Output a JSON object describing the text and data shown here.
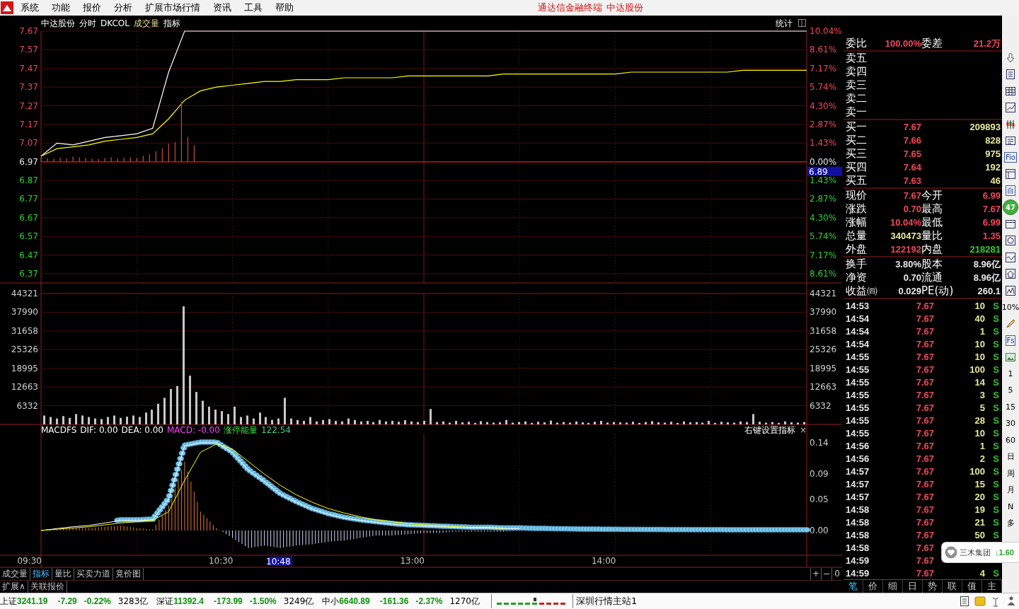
{
  "menu": {
    "items": [
      "系统",
      "功能",
      "报价",
      "分析",
      "扩展市场行情",
      "资讯",
      "工具",
      "帮助"
    ],
    "app_title": "通达信金融终端",
    "stock": "中达股份"
  },
  "chart_header": {
    "items": [
      "中达股份",
      "分时",
      "DKCOL",
      "成交量",
      "指标"
    ],
    "stats_button": "统计"
  },
  "price_chart": {
    "chart_data": {
      "type": "line",
      "ylim": [
        6.37,
        7.67
      ],
      "categories": [
        null,
        null,
        null,
        null,
        null,
        null,
        null,
        null,
        null,
        null,
        null,
        null,
        null,
        null,
        null,
        null,
        null,
        null,
        null,
        null,
        null,
        null,
        null,
        null,
        null,
        null,
        null,
        null,
        null,
        null,
        null,
        null,
        null,
        null,
        null,
        null,
        null,
        null,
        null,
        null,
        null,
        null,
        null,
        null,
        null,
        null,
        null,
        null,
        null
      ],
      "yticks": [
        {
          "value": 7.67,
          "label": "7.67"
        },
        {
          "value": 7.57,
          "label": "7.57"
        },
        {
          "value": 7.47,
          "label": "7.47"
        },
        {
          "value": 7.37,
          "label": "7.37"
        },
        {
          "value": 7.27,
          "label": "7.27"
        },
        {
          "value": 7.17,
          "label": "7.17"
        },
        {
          "value": 7.07,
          "label": "7.07"
        },
        {
          "value": 6.97,
          "label": "6.97"
        },
        {
          "value": 6.87,
          "label": "6.87"
        },
        {
          "value": 6.77,
          "label": "6.77"
        },
        {
          "value": 6.67,
          "label": "6.67"
        },
        {
          "value": 6.57,
          "label": "6.57"
        },
        {
          "value": 6.47,
          "label": "6.47"
        },
        {
          "value": 6.37,
          "label": "6.37"
        }
      ],
      "series": [
        {
          "color": "#ffffff",
          "values": [
            7.0,
            7.07,
            7.06,
            7.08,
            7.1,
            7.11,
            7.12,
            7.15,
            7.45,
            7.67,
            7.67,
            7.67,
            7.67,
            7.67,
            7.67,
            7.67,
            7.67,
            7.67,
            7.67,
            7.67,
            7.67,
            7.67,
            7.67,
            7.67,
            7.67,
            7.67,
            7.67,
            7.67,
            7.67,
            7.67,
            7.67,
            7.67,
            7.67,
            7.67,
            7.67,
            7.67,
            7.67,
            7.67,
            7.67,
            7.67,
            7.67,
            7.67,
            7.67,
            7.67,
            7.67,
            7.67,
            7.67,
            7.67,
            7.67
          ]
        },
        {
          "color": "#ffff00",
          "values": [
            7.0,
            7.04,
            7.05,
            7.06,
            7.08,
            7.09,
            7.1,
            7.12,
            7.2,
            7.3,
            7.35,
            7.37,
            7.38,
            7.39,
            7.4,
            7.4,
            7.41,
            7.41,
            7.41,
            7.42,
            7.42,
            7.42,
            7.42,
            7.43,
            7.43,
            7.43,
            7.43,
            7.43,
            7.43,
            7.44,
            7.44,
            7.44,
            7.44,
            7.44,
            7.44,
            7.44,
            7.44,
            7.45,
            7.45,
            7.45,
            7.45,
            7.45,
            7.45,
            7.45,
            7.46,
            7.46,
            7.46,
            7.46,
            7.46
          ]
        }
      ]
    },
    "cursor_label": "6.89",
    "right_labels": [
      {
        "label": "10.04%",
        "color": "#f04858"
      },
      {
        "label": "8.61%",
        "color": "#f04858"
      },
      {
        "label": "7.17%",
        "color": "#f04858"
      },
      {
        "label": "5.74%",
        "color": "#f04858"
      },
      {
        "label": "4.30%",
        "color": "#f04858"
      },
      {
        "label": "2.87%",
        "color": "#f04858"
      },
      {
        "label": "1.43%",
        "color": "#f04858"
      },
      {
        "label": "0.00%",
        "color": "#e8e8e8"
      },
      {
        "label": "1.43%",
        "color": "#30d030"
      },
      {
        "label": "2.87%",
        "color": "#30d030"
      },
      {
        "label": "4.30%",
        "color": "#30d030"
      },
      {
        "label": "5.74%",
        "color": "#30d030"
      },
      {
        "label": "7.17%",
        "color": "#30d030"
      },
      {
        "label": "8.61%",
        "color": "#30d030"
      }
    ]
  },
  "volume_chart": {
    "chart_data": {
      "type": "bar",
      "ylim": [
        0,
        44321
      ],
      "yticks": [
        {
          "value": 44321,
          "label": "44321"
        },
        {
          "value": 37990,
          "label": "37990"
        },
        {
          "value": 31658,
          "label": "31658"
        },
        {
          "value": 25326,
          "label": "25326"
        },
        {
          "value": 18995,
          "label": "18995"
        },
        {
          "value": 12663,
          "label": "12663"
        },
        {
          "value": 6332,
          "label": "6332"
        }
      ],
      "categories": [
        null,
        null,
        null,
        null,
        null,
        null,
        null,
        null,
        null,
        null,
        null,
        null,
        null,
        null,
        null,
        null,
        null,
        null,
        null,
        null,
        null,
        null,
        null,
        null,
        null,
        null,
        null,
        null,
        null,
        null,
        null,
        null,
        null,
        null,
        null,
        null,
        null,
        null,
        null,
        null,
        null,
        null,
        null,
        null,
        null,
        null,
        null,
        null,
        null,
        null,
        null,
        null,
        null,
        null,
        null,
        null,
        null,
        null,
        null,
        null,
        null,
        null,
        null,
        null,
        null,
        null,
        null,
        null,
        null,
        null,
        null,
        null,
        null,
        null,
        null,
        null,
        null,
        null,
        null,
        null,
        null,
        null,
        null,
        null,
        null,
        null,
        null,
        null,
        null,
        null,
        null,
        null,
        null,
        null,
        null,
        null,
        null,
        null,
        null,
        null,
        null,
        null,
        null,
        null,
        null,
        null,
        null,
        null,
        null,
        null,
        null,
        null,
        null,
        null,
        null,
        null,
        null,
        null,
        null,
        null,
        null
      ],
      "series": [
        {
          "color": "#c8c8c8",
          "values": [
            3000,
            2500,
            2000,
            2800,
            2200,
            3500,
            3000,
            2500,
            2000,
            1800,
            2500,
            3000,
            2200,
            2600,
            3000,
            2500,
            4000,
            5000,
            7000,
            9000,
            12000,
            13000,
            40000,
            16500,
            11000,
            8000,
            6000,
            5000,
            4500,
            3500,
            6000,
            2500,
            3000,
            2000,
            4000,
            2500,
            1500,
            2000,
            9000,
            2000,
            1500,
            1200,
            2500,
            1000,
            1500,
            1800,
            1200,
            1000,
            2000,
            1500,
            1000,
            1200,
            800,
            1500,
            1000,
            1200,
            900,
            1400,
            1000,
            800,
            1200,
            5200,
            800,
            1000,
            600,
            1200,
            700,
            900,
            500,
            1100,
            800,
            600,
            700,
            1500,
            600,
            800,
            1000,
            500,
            900,
            700,
            1300,
            600,
            800,
            600,
            1000,
            700,
            500,
            900,
            1200,
            600,
            800,
            700,
            600,
            900,
            500,
            800,
            1100,
            700,
            600,
            900,
            500,
            1000,
            700,
            800,
            600,
            1200,
            500,
            900,
            700,
            600,
            1000,
            800,
            3500,
            900,
            600,
            800,
            500,
            1000,
            700,
            600,
            800
          ]
        }
      ]
    },
    "right_labels": [
      "44321",
      "37990",
      "31658",
      "25326",
      "18995",
      "12663",
      "6332"
    ]
  },
  "macd_chart": {
    "legend": [
      "MACDFS",
      "DIF: 0.00",
      "DEA: 0.00",
      "MACD: -0.00",
      "涨停能量",
      "122.54"
    ],
    "settings_hint": "右键设置指标",
    "close": "×",
    "chart_data": {
      "type": "line",
      "ylim": [
        0,
        0.14
      ],
      "categories": [
        null,
        null,
        null,
        null,
        null,
        null,
        null,
        null,
        null,
        null,
        null,
        null,
        null,
        null,
        null,
        null,
        null,
        null,
        null,
        null,
        null,
        null,
        null,
        null,
        null,
        null,
        null,
        null,
        null,
        null,
        null,
        null,
        null,
        null,
        null,
        null,
        null,
        null,
        null,
        null,
        null,
        null,
        null,
        null,
        null,
        null,
        null,
        null,
        null
      ],
      "yticks": [
        {
          "value": 0.14,
          "label": "0.14"
        },
        {
          "value": 0.09,
          "label": "0.09"
        },
        {
          "value": 0.05,
          "label": "0.05"
        },
        {
          "value": 0,
          "label": "0.00"
        }
      ],
      "series": [
        {
          "color": "#ffffff",
          "values": [
            0,
            0.003,
            0.006,
            0.008,
            0.012,
            0.016,
            0.016,
            0.017,
            0.05,
            0.135,
            0.14,
            0.14,
            0.124,
            0.096,
            0.078,
            0.058,
            0.045,
            0.034,
            0.026,
            0.02,
            0.016,
            0.013,
            0.01,
            0.008,
            0.007,
            0.006,
            0.005,
            0.004,
            0.004,
            0.003,
            0.003,
            null,
            null,
            null,
            null,
            null,
            null,
            null,
            null,
            null,
            null,
            null,
            null,
            null,
            null,
            null,
            null,
            null,
            null
          ]
        },
        {
          "color": "#ffff00",
          "values": [
            0,
            0.002,
            0.004,
            0.006,
            0.009,
            0.012,
            0.014,
            0.016,
            0.03,
            0.08,
            0.125,
            0.138,
            0.13,
            0.11,
            0.09,
            0.072,
            0.057,
            0.045,
            0.035,
            0.028,
            0.022,
            0.017,
            0.014,
            0.011,
            0.009,
            0.008,
            0.006,
            0.005,
            0.005,
            0.004,
            null,
            null,
            null,
            null,
            null,
            null,
            null,
            null,
            null,
            null,
            null,
            null,
            null,
            null,
            null,
            null,
            null,
            null,
            null
          ]
        }
      ]
    },
    "time_labels": [
      "09:30",
      "10:30",
      "13:00",
      "14:00"
    ],
    "cursor_time": "10:48"
  },
  "bottom_tabs": [
    {
      "label": "成交量",
      "selected": false
    },
    {
      "label": "指标",
      "selected": true
    },
    {
      "label": "量比",
      "selected": false
    },
    {
      "label": "买卖力道",
      "selected": false
    },
    {
      "label": "竟价图",
      "selected": false
    }
  ],
  "zoom_buttons": [
    "+",
    "−",
    "0"
  ],
  "sub_tabs": [
    "扩展∧",
    "关联报价"
  ],
  "quote": {
    "order_ratio": [
      {
        "label": "委比",
        "value": "100.00%",
        "color": "#f04858"
      },
      {
        "label": "委差",
        "value": "21.2万",
        "color": "#f04858"
      }
    ],
    "sell": [
      "卖五",
      "卖四",
      "卖三",
      "卖二",
      "卖一"
    ],
    "buy": [
      {
        "label": "买一",
        "price": "7.67",
        "volume": "209893"
      },
      {
        "label": "买二",
        "price": "7.66",
        "volume": "828"
      },
      {
        "label": "买三",
        "price": "7.65",
        "volume": "975"
      },
      {
        "label": "买四",
        "price": "7.64",
        "volume": "192"
      },
      {
        "label": "买五",
        "price": "7.63",
        "volume": "46"
      }
    ],
    "stats": [
      [
        {
          "label": "现价",
          "value": "7.67",
          "color": "#f04858"
        },
        {
          "label": "今开",
          "value": "6.99",
          "color": "#f04858"
        }
      ],
      [
        {
          "label": "涨跌",
          "value": "0.70",
          "color": "#f04858"
        },
        {
          "label": "最高",
          "value": "7.67",
          "color": "#f04858"
        }
      ],
      [
        {
          "label": "涨幅",
          "value": "10.04%",
          "color": "#f04858"
        },
        {
          "label": "最低",
          "value": "6.99",
          "color": "#f04858"
        }
      ],
      [
        {
          "label": "总量",
          "value": "340473",
          "color": "#e8e8a0"
        },
        {
          "label": "量比",
          "value": "1.35",
          "color": "#f04858"
        }
      ],
      [
        {
          "label": "外盘",
          "value": "122192",
          "color": "#f04858"
        },
        {
          "label": "内盘",
          "value": "218281",
          "color": "#30d030"
        }
      ]
    ],
    "fundamentals": [
      [
        {
          "label": "换手",
          "value": "3.80%",
          "color": "#e8e8e8"
        },
        {
          "label": "股本",
          "value": "8.96亿",
          "color": "#e8e8e8"
        }
      ],
      [
        {
          "label": "净资",
          "value": "0.70",
          "color": "#e8e8e8"
        },
        {
          "label": "流通",
          "value": "8.96亿",
          "color": "#e8e8e8"
        }
      ],
      [
        {
          "label": "收益㈣",
          "value": "0.029",
          "color": "#e8e8e8"
        },
        {
          "label": "PE(动)",
          "value": "260.1",
          "color": "#e8e8e8"
        }
      ]
    ]
  },
  "ticks": [
    {
      "time": "14:53",
      "price": "7.67",
      "volume": "10",
      "side": "S",
      "color": "#30c030"
    },
    {
      "time": "14:54",
      "price": "7.67",
      "volume": "40",
      "side": "S",
      "color": "#30c030"
    },
    {
      "time": "14:54",
      "price": "7.67",
      "volume": "1",
      "side": "S",
      "color": "#30c030"
    },
    {
      "time": "14:54",
      "price": "7.67",
      "volume": "10",
      "side": "S",
      "color": "#30c030"
    },
    {
      "time": "14:55",
      "price": "7.67",
      "volume": "10",
      "side": "S",
      "color": "#30c030"
    },
    {
      "time": "14:55",
      "price": "7.67",
      "volume": "100",
      "side": "S",
      "color": "#30c030"
    },
    {
      "time": "14:55",
      "price": "7.67",
      "volume": "14",
      "side": "S",
      "color": "#30c030"
    },
    {
      "time": "14:55",
      "price": "7.67",
      "volume": "3",
      "side": "S",
      "color": "#30c030"
    },
    {
      "time": "14:55",
      "price": "7.67",
      "volume": "5",
      "side": "S",
      "color": "#30c030"
    },
    {
      "time": "14:55",
      "price": "7.67",
      "volume": "28",
      "side": "S",
      "color": "#30c030"
    },
    {
      "time": "14:55",
      "price": "7.67",
      "volume": "10",
      "side": "S",
      "color": "#30c030"
    },
    {
      "time": "14:56",
      "price": "7.67",
      "volume": "1",
      "side": "S",
      "color": "#30c030"
    },
    {
      "time": "14:56",
      "price": "7.67",
      "volume": "2",
      "side": "S",
      "color": "#30c030"
    },
    {
      "time": "14:57",
      "price": "7.67",
      "volume": "100",
      "side": "S",
      "color": "#30c030"
    },
    {
      "time": "14:57",
      "price": "7.67",
      "volume": "15",
      "side": "S",
      "color": "#30c030"
    },
    {
      "time": "14:57",
      "price": "7.67",
      "volume": "20",
      "side": "S",
      "color": "#30c030"
    },
    {
      "time": "14:58",
      "price": "7.67",
      "volume": "19",
      "side": "S",
      "color": "#30c030"
    },
    {
      "time": "14:58",
      "price": "7.67",
      "volume": "21",
      "side": "S",
      "color": "#30c030"
    },
    {
      "time": "14:58",
      "price": "7.67",
      "volume": "50",
      "side": "S",
      "color": "#30c030"
    },
    {
      "time": "14:58",
      "price": "7.67"
    },
    {
      "time": "14:59",
      "price": "7.67"
    },
    {
      "time": "14:59",
      "price": "7.67",
      "volume": "4",
      "side": "S",
      "color": "#30c030"
    }
  ],
  "panel_tabs": [
    {
      "label": "笔",
      "selected": true
    },
    {
      "label": "价",
      "selected": false
    },
    {
      "label": "细",
      "selected": false
    },
    {
      "label": "日",
      "selected": false
    },
    {
      "label": "势",
      "selected": false
    },
    {
      "label": "联",
      "selected": false
    },
    {
      "label": "值",
      "selected": false
    },
    {
      "label": "主",
      "selected": false
    }
  ],
  "toolbar": [
    {
      "kind": "icon"
    },
    {
      "kind": "icon"
    },
    {
      "kind": "icon"
    },
    {
      "kind": "icon"
    },
    {
      "kind": "icon"
    },
    {
      "kind": "icon"
    },
    {
      "kind": "boxed",
      "text": "Fio"
    },
    {
      "kind": "icon"
    },
    {
      "kind": "boxed",
      "text": "自"
    },
    {
      "kind": "badge",
      "text": "47"
    },
    {
      "kind": "icon"
    },
    {
      "kind": "icon"
    },
    {
      "kind": "icon"
    },
    {
      "kind": "icon"
    },
    {
      "kind": "icon"
    },
    {
      "kind": "text",
      "text": "10%"
    },
    {
      "kind": "icon"
    },
    {
      "kind": "boxed",
      "text": "Fs"
    },
    {
      "kind": "icon"
    },
    {
      "kind": "text",
      "text": "1"
    },
    {
      "kind": "text",
      "text": "5"
    },
    {
      "kind": "text",
      "text": "15"
    },
    {
      "kind": "text",
      "text": "30"
    },
    {
      "kind": "text",
      "text": "60"
    },
    {
      "kind": "text",
      "text": "日"
    },
    {
      "kind": "text",
      "text": "周"
    },
    {
      "kind": "text",
      "text": "月"
    },
    {
      "kind": "text",
      "text": "N"
    },
    {
      "kind": "text",
      "text": "多"
    }
  ],
  "popup": {
    "name": "三木集团",
    "change": "↓1.60"
  },
  "status_bar": {
    "indices": [
      {
        "name": "上证",
        "value": "3241.19",
        "change": "-7.29",
        "percent": "-0.22%",
        "amount": "3283亿",
        "color": "#109010"
      },
      {
        "name": "深证",
        "value": "11392.4",
        "change": "-173.99",
        "percent": "-1.50%",
        "amount": "3249亿",
        "color": "#109010"
      },
      {
        "name": "中小",
        "value": "6640.89",
        "change": "-161.36",
        "percent": "-2.37%",
        "amount": "1270亿",
        "color": "#109010"
      }
    ],
    "server": "深圳行情主站1"
  }
}
